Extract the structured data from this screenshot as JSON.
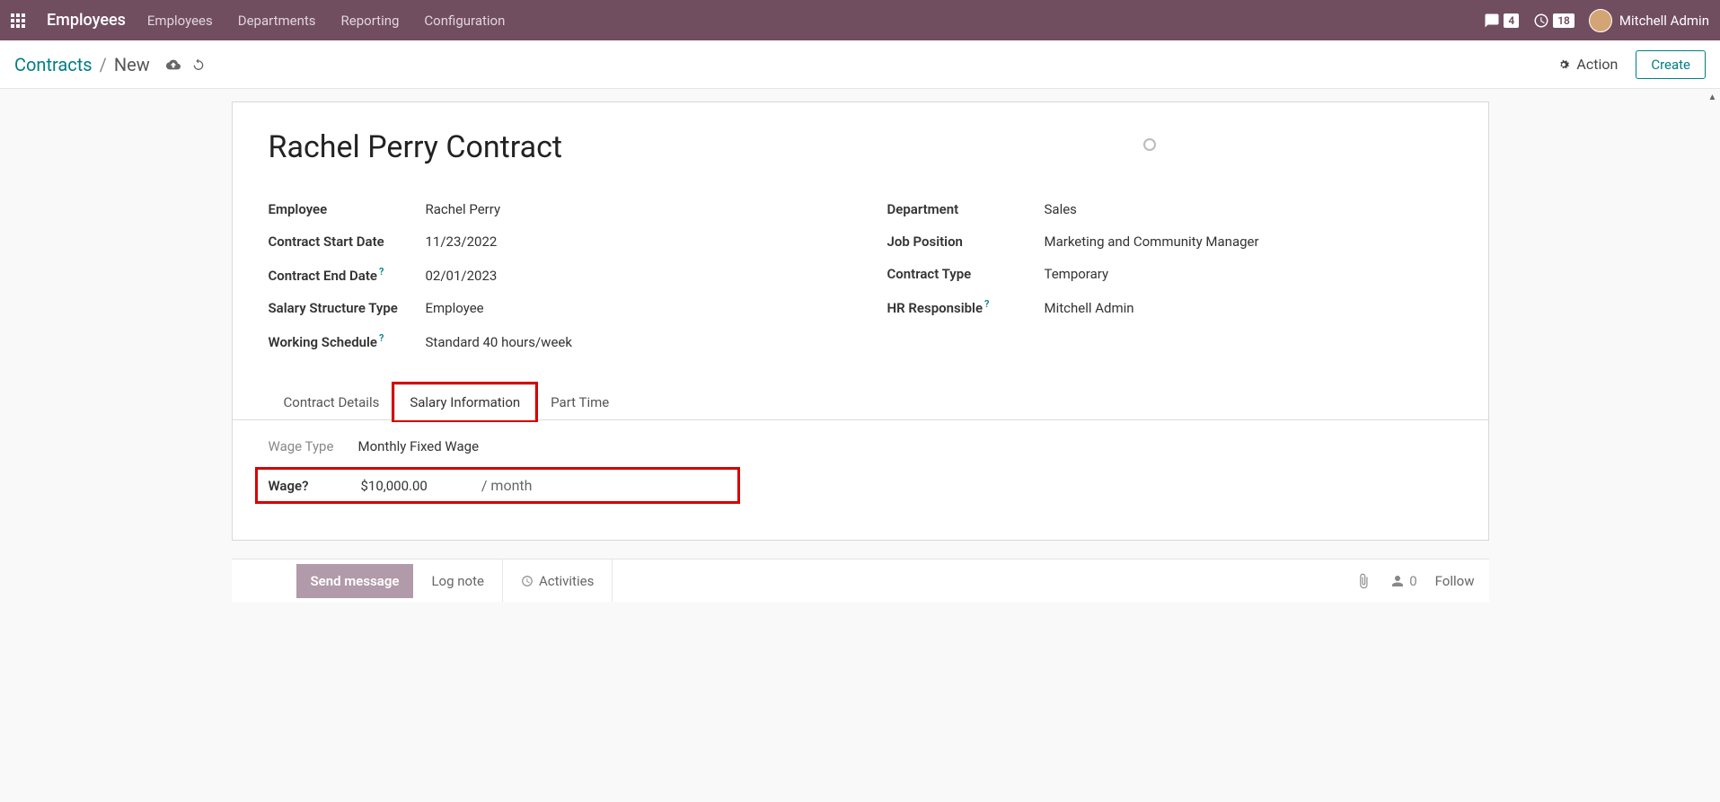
{
  "topbar": {
    "app_name": "Employees",
    "nav": [
      "Employees",
      "Departments",
      "Reporting",
      "Configuration"
    ],
    "discuss_badge": "4",
    "activity_badge": "18",
    "username": "Mitchell Admin"
  },
  "breadcrumb": {
    "parent": "Contracts",
    "current": "New"
  },
  "actions": {
    "action_label": "Action",
    "create_label": "Create"
  },
  "form": {
    "title": "Rachel Perry Contract",
    "left": {
      "employee": {
        "label": "Employee",
        "value": "Rachel Perry"
      },
      "start_date": {
        "label": "Contract Start Date",
        "value": "11/23/2022"
      },
      "end_date": {
        "label": "Contract End Date",
        "value": "02/01/2023"
      },
      "salary_structure": {
        "label": "Salary Structure Type",
        "value": "Employee"
      },
      "working_schedule": {
        "label": "Working Schedule",
        "value": "Standard 40 hours/week"
      }
    },
    "right": {
      "department": {
        "label": "Department",
        "value": "Sales"
      },
      "job_position": {
        "label": "Job Position",
        "value": "Marketing and Community Manager"
      },
      "contract_type": {
        "label": "Contract Type",
        "value": "Temporary"
      },
      "hr_responsible": {
        "label": "HR Responsible",
        "value": "Mitchell Admin"
      }
    }
  },
  "tabs": {
    "contract_details": "Contract Details",
    "salary_info": "Salary Information",
    "part_time": "Part Time"
  },
  "salary": {
    "wage_type": {
      "label": "Wage Type",
      "value": "Monthly Fixed Wage"
    },
    "wage": {
      "label": "Wage",
      "value": "$10,000.00",
      "unit": "/ month"
    }
  },
  "bottom": {
    "send_message": "Send message",
    "log_note": "Log note",
    "activities": "Activities",
    "followers": "0",
    "follow": "Follow"
  }
}
